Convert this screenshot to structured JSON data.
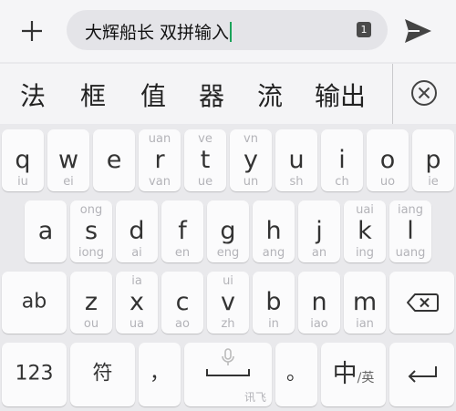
{
  "compose": {
    "text": "大辉船长 双拼输入",
    "ime_badge": "1",
    "plus_icon": "plus-icon",
    "send_icon": "send-icon"
  },
  "candidates": [
    "法",
    "框",
    "值",
    "器",
    "流",
    "输出"
  ],
  "keyboard": {
    "row1": [
      {
        "key": "q",
        "sup": "",
        "sub": "iu"
      },
      {
        "key": "w",
        "sup": "",
        "sub": "ei"
      },
      {
        "key": "e",
        "sup": "",
        "sub": ""
      },
      {
        "key": "r",
        "sup": "uan",
        "sub": "van"
      },
      {
        "key": "t",
        "sup": "ve",
        "sub": "ue"
      },
      {
        "key": "y",
        "sup": "vn",
        "sub": "un"
      },
      {
        "key": "u",
        "sup": "",
        "sub": "sh"
      },
      {
        "key": "i",
        "sup": "",
        "sub": "ch"
      },
      {
        "key": "o",
        "sup": "",
        "sub": "uo"
      },
      {
        "key": "p",
        "sup": "",
        "sub": "ie"
      }
    ],
    "row2": [
      {
        "key": "a",
        "sup": "",
        "sub": ""
      },
      {
        "key": "s",
        "sup": "ong",
        "sub": "iong"
      },
      {
        "key": "d",
        "sup": "",
        "sub": "ai"
      },
      {
        "key": "f",
        "sup": "",
        "sub": "en"
      },
      {
        "key": "g",
        "sup": "",
        "sub": "eng"
      },
      {
        "key": "h",
        "sup": "",
        "sub": "ang"
      },
      {
        "key": "j",
        "sup": "",
        "sub": "an"
      },
      {
        "key": "k",
        "sup": "uai",
        "sub": "ing"
      },
      {
        "key": "l",
        "sup": "iang",
        "sub": "uang"
      }
    ],
    "row3": [
      {
        "key": "z",
        "sup": "",
        "sub": "ou"
      },
      {
        "key": "x",
        "sup": "ia",
        "sub": "ua"
      },
      {
        "key": "c",
        "sup": "",
        "sub": "ao"
      },
      {
        "key": "v",
        "sup": "ui",
        "sub": "zh"
      },
      {
        "key": "b",
        "sup": "",
        "sub": "in"
      },
      {
        "key": "n",
        "sup": "",
        "sub": "iao"
      },
      {
        "key": "m",
        "sup": "",
        "sub": "ian"
      }
    ],
    "ab_label": "ab",
    "num_label": "123",
    "symbol_label": "符",
    "comma_label": "，",
    "voice_label": "讯飞",
    "period_label": "。",
    "lang_main": "中",
    "lang_sep": "/",
    "lang_alt": "英"
  }
}
